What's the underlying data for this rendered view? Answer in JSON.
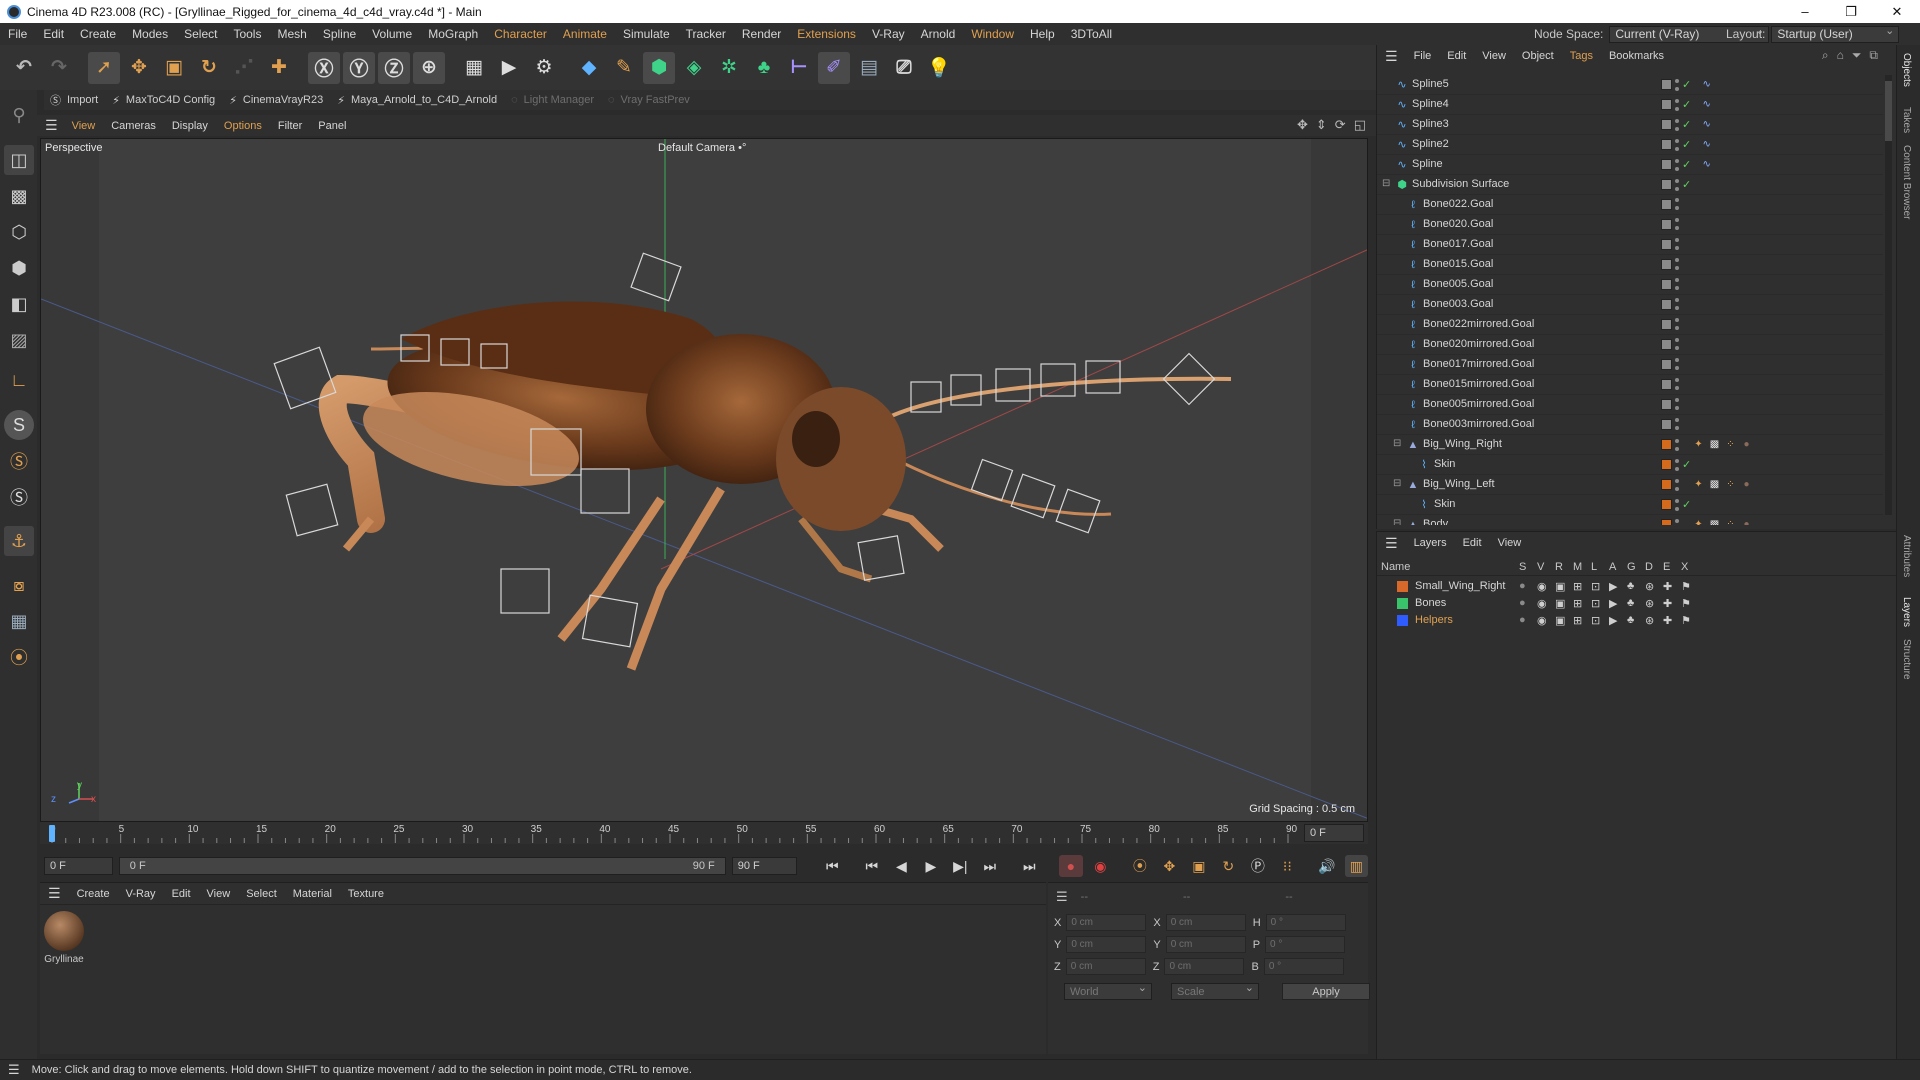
{
  "window": {
    "title": "Cinema 4D R23.008 (RC) - [Gryllinae_Rigged_for_cinema_4d_c4d_vray.c4d *] - Main",
    "minimize": "–",
    "maximize": "❐",
    "close": "✕"
  },
  "menubar": {
    "items": [
      "File",
      "Edit",
      "Create",
      "Modes",
      "Select",
      "Tools",
      "Mesh",
      "Spline",
      "Volume",
      "MoGraph",
      "Character",
      "Animate",
      "Simulate",
      "Tracker",
      "Render",
      "Extensions",
      "V-Ray",
      "Arnold",
      "Window",
      "Help",
      "3DToAll"
    ],
    "node_space_label": "Node Space:",
    "node_space_value": "Current (V-Ray)",
    "layout_label": "Layout:",
    "layout_value": "Startup (User)"
  },
  "pluginbar": {
    "items": [
      "Import",
      "MaxToC4D Config",
      "CinemaVrayR23",
      "Maya_Arnold_to_C4D_Arnold",
      "Light Manager",
      "Vray FastPrev"
    ]
  },
  "viewport": {
    "menu": [
      "View",
      "Cameras",
      "Display",
      "Options",
      "Filter",
      "Panel"
    ],
    "projection": "Perspective",
    "camera": "Default Camera",
    "camera_icon": "•°",
    "grid_spacing": "Grid Spacing : 0.5 cm",
    "axis_x": "x",
    "axis_y": "y",
    "axis_z": "z"
  },
  "timeline": {
    "ticks": [
      "0",
      "5",
      "10",
      "15",
      "20",
      "25",
      "30",
      "35",
      "40",
      "45",
      "50",
      "55",
      "60",
      "65",
      "70",
      "75",
      "80",
      "85",
      "90"
    ],
    "current_frame_display": "0 F",
    "start_field": "0 F",
    "range_start": "0 F",
    "range_end": "90 F",
    "end_field": "90 F",
    "current": 0,
    "end": 90
  },
  "material_manager": {
    "menu": [
      "Create",
      "V-Ray",
      "Edit",
      "View",
      "Select",
      "Material",
      "Texture"
    ],
    "materials": [
      {
        "name": "Gryllinae"
      }
    ]
  },
  "coordinates": {
    "header_a": "--",
    "header_b": "--",
    "header_c": "--",
    "rows": [
      {
        "a_label": "X",
        "a_value": "0 cm",
        "b_label": "X",
        "b_value": "0 cm",
        "c_label": "H",
        "c_value": "0 °"
      },
      {
        "a_label": "Y",
        "a_value": "0 cm",
        "b_label": "Y",
        "b_value": "0 cm",
        "c_label": "P",
        "c_value": "0 °"
      },
      {
        "a_label": "Z",
        "a_value": "0 cm",
        "b_label": "Z",
        "b_value": "0 cm",
        "c_label": "B",
        "c_value": "0 °"
      }
    ],
    "space_value": "World",
    "mode_value": "Scale",
    "apply_label": "Apply"
  },
  "object_manager": {
    "menu": [
      "File",
      "Edit",
      "View",
      "Object",
      "Tags",
      "Bookmarks"
    ],
    "rows": [
      {
        "name": "Spline5",
        "indent": 1,
        "icon": "spline"
      },
      {
        "name": "Spline4",
        "indent": 1,
        "icon": "spline"
      },
      {
        "name": "Spline3",
        "indent": 1,
        "icon": "spline"
      },
      {
        "name": "Spline2",
        "indent": 1,
        "icon": "spline"
      },
      {
        "name": "Spline",
        "indent": 1,
        "icon": "spline"
      },
      {
        "name": "Subdivision Surface",
        "indent": 1,
        "icon": "subdiv"
      },
      {
        "name": "Bone022.Goal",
        "indent": 2,
        "icon": "null"
      },
      {
        "name": "Bone020.Goal",
        "indent": 2,
        "icon": "null"
      },
      {
        "name": "Bone017.Goal",
        "indent": 2,
        "icon": "null"
      },
      {
        "name": "Bone015.Goal",
        "indent": 2,
        "icon": "null"
      },
      {
        "name": "Bone005.Goal",
        "indent": 2,
        "icon": "null"
      },
      {
        "name": "Bone003.Goal",
        "indent": 2,
        "icon": "null"
      },
      {
        "name": "Bone022mirrored.Goal",
        "indent": 2,
        "icon": "null"
      },
      {
        "name": "Bone020mirrored.Goal",
        "indent": 2,
        "icon": "null"
      },
      {
        "name": "Bone017mirrored.Goal",
        "indent": 2,
        "icon": "null"
      },
      {
        "name": "Bone015mirrored.Goal",
        "indent": 2,
        "icon": "null"
      },
      {
        "name": "Bone005mirrored.Goal",
        "indent": 2,
        "icon": "null"
      },
      {
        "name": "Bone003mirrored.Goal",
        "indent": 2,
        "icon": "null"
      },
      {
        "name": "Big_Wing_Right",
        "indent": 2,
        "icon": "poly"
      },
      {
        "name": "Skin",
        "indent": 3,
        "icon": "skin"
      },
      {
        "name": "Big_Wing_Left",
        "indent": 2,
        "icon": "poly"
      },
      {
        "name": "Skin",
        "indent": 3,
        "icon": "skin"
      },
      {
        "name": "Body",
        "indent": 2,
        "icon": "poly"
      }
    ]
  },
  "layer_manager": {
    "menu": [
      "Layers",
      "Edit",
      "View"
    ],
    "columns": {
      "name": "Name",
      "flags": [
        "S",
        "V",
        "R",
        "M",
        "L",
        "A",
        "G",
        "D",
        "E",
        "X"
      ]
    },
    "layers": [
      {
        "name": "Small_Wing_Right",
        "color": "#d9692a",
        "highlight": false
      },
      {
        "name": "Bones",
        "color": "#39c46b",
        "highlight": false
      },
      {
        "name": "Helpers",
        "color": "#2f5cff",
        "highlight": true
      }
    ]
  },
  "right_tabs": [
    "Objects",
    "Takes",
    "Content Browser",
    "Attributes",
    "Layers",
    "Structure"
  ],
  "status": {
    "text": "Move: Click and drag to move elements. Hold down SHIFT to quantize movement / add to the selection in point mode, CTRL to remove."
  },
  "colors": {
    "accent": "#e0a050",
    "orange_tag": "#d46a1c",
    "check_green": "#5fd35f",
    "viewport_bg": "#3e3e3e"
  }
}
